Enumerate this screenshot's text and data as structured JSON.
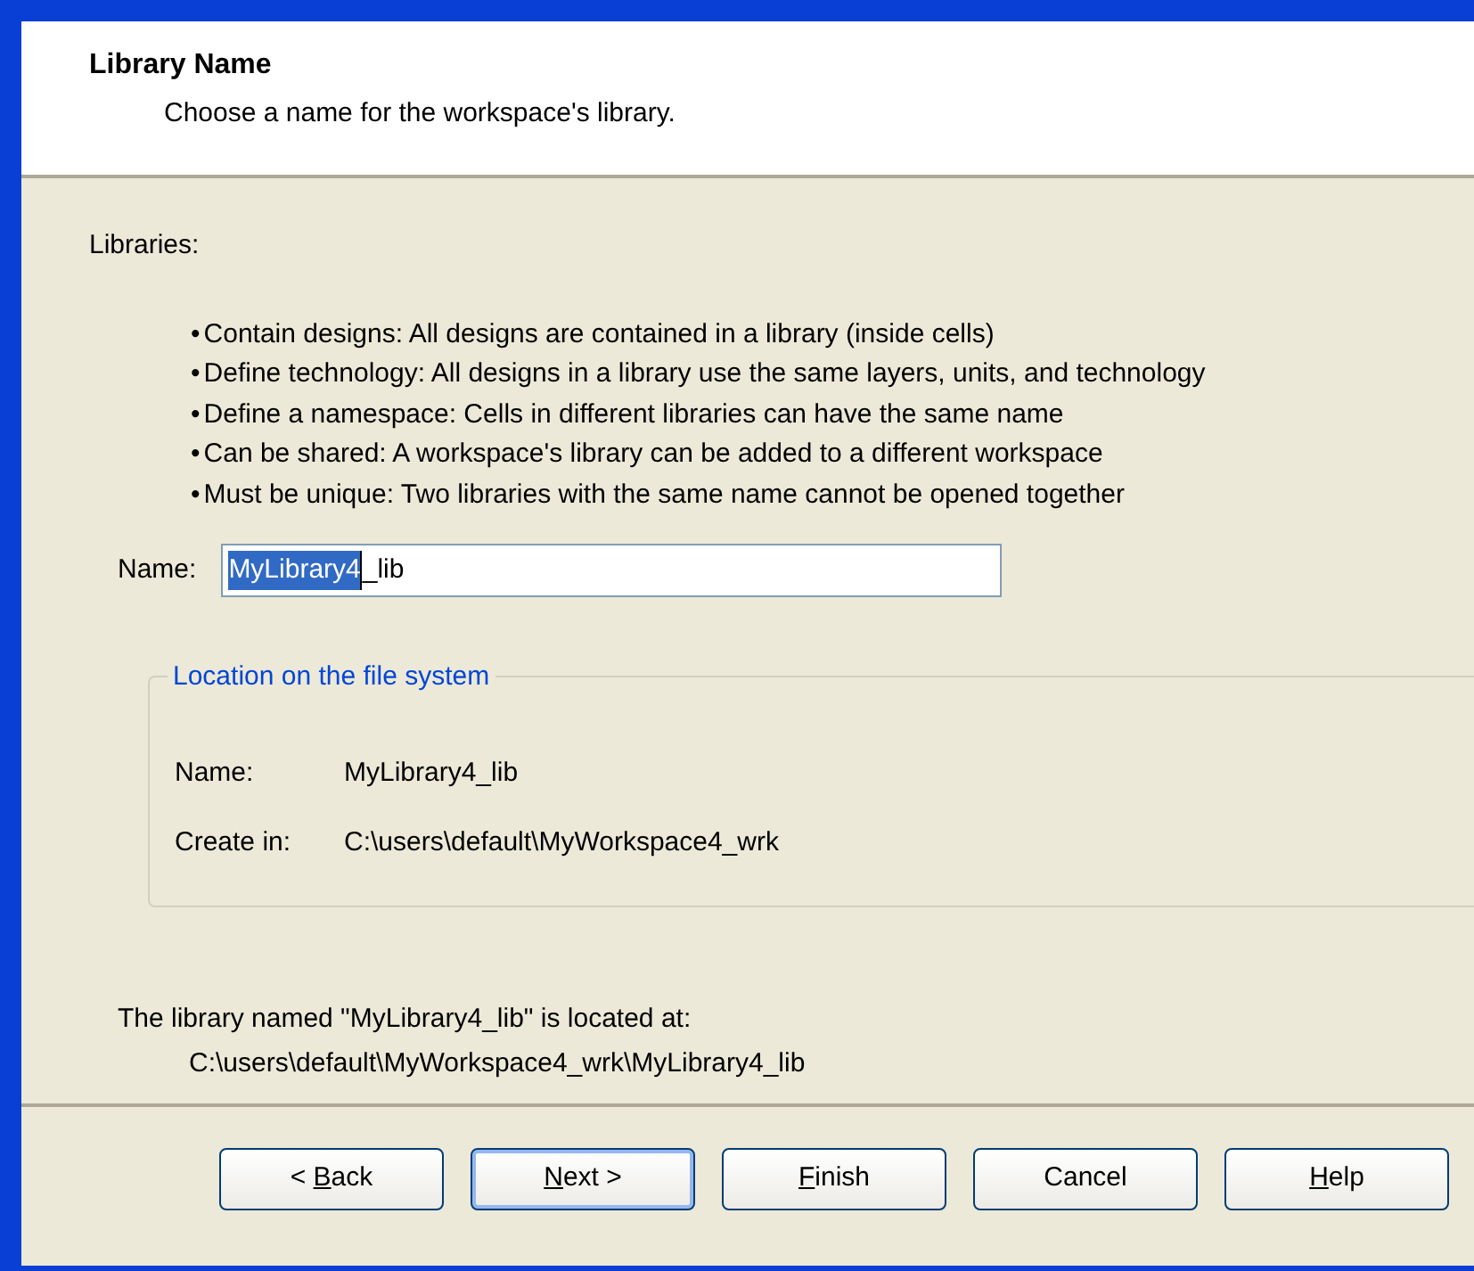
{
  "header": {
    "title": "Library Name",
    "subtitle": "Choose a name for the workspace's library."
  },
  "intro": "Libraries:",
  "bullets": [
    {
      "bullet": "•",
      "text": "Contain designs: All designs are contained in a library (inside cells)"
    },
    {
      "bullet": "•",
      "text": "Define technology: All designs in a library use the same layers, units, and technology"
    },
    {
      "bullet": "•",
      "text": "Define a namespace: Cells in different libraries can have the same name"
    },
    {
      "bullet": "•",
      "text": "Can be shared: A workspace's library can be added to a different workspace"
    },
    {
      "bullet": "•",
      "text": "Must be unique: Two libraries with the same name cannot be opened together"
    }
  ],
  "name_field": {
    "label": "Name:",
    "value_selected": "MyLibrary4",
    "value_rest": "_lib"
  },
  "location_group": {
    "title": "Location on the file system",
    "rows": [
      {
        "label": "Name:",
        "value": "MyLibrary4_lib"
      },
      {
        "label": "Create in:",
        "value": "C:\\users\\default\\MyWorkspace4_wrk"
      }
    ]
  },
  "summary": {
    "line_1": "The library named \"MyLibrary4_lib\" is located at:",
    "line_2": "C:\\users\\default\\MyWorkspace4_wrk\\MyLibrary4_lib"
  },
  "buttons": [
    {
      "parts": [
        {
          "text": "< ",
          "underline": false
        },
        {
          "text": "B",
          "underline": true
        },
        {
          "text": "ack",
          "underline": false
        }
      ],
      "default": false
    },
    {
      "parts": [
        {
          "text": "N",
          "underline": true
        },
        {
          "text": "ext >",
          "underline": false
        }
      ],
      "default": true
    },
    {
      "parts": [
        {
          "text": "F",
          "underline": true
        },
        {
          "text": "inish",
          "underline": false
        }
      ],
      "default": false
    },
    {
      "parts": [
        {
          "text": "Cancel",
          "underline": false
        }
      ],
      "default": false
    },
    {
      "parts": [
        {
          "text": "H",
          "underline": true
        },
        {
          "text": "elp",
          "underline": false
        }
      ],
      "default": false
    }
  ]
}
